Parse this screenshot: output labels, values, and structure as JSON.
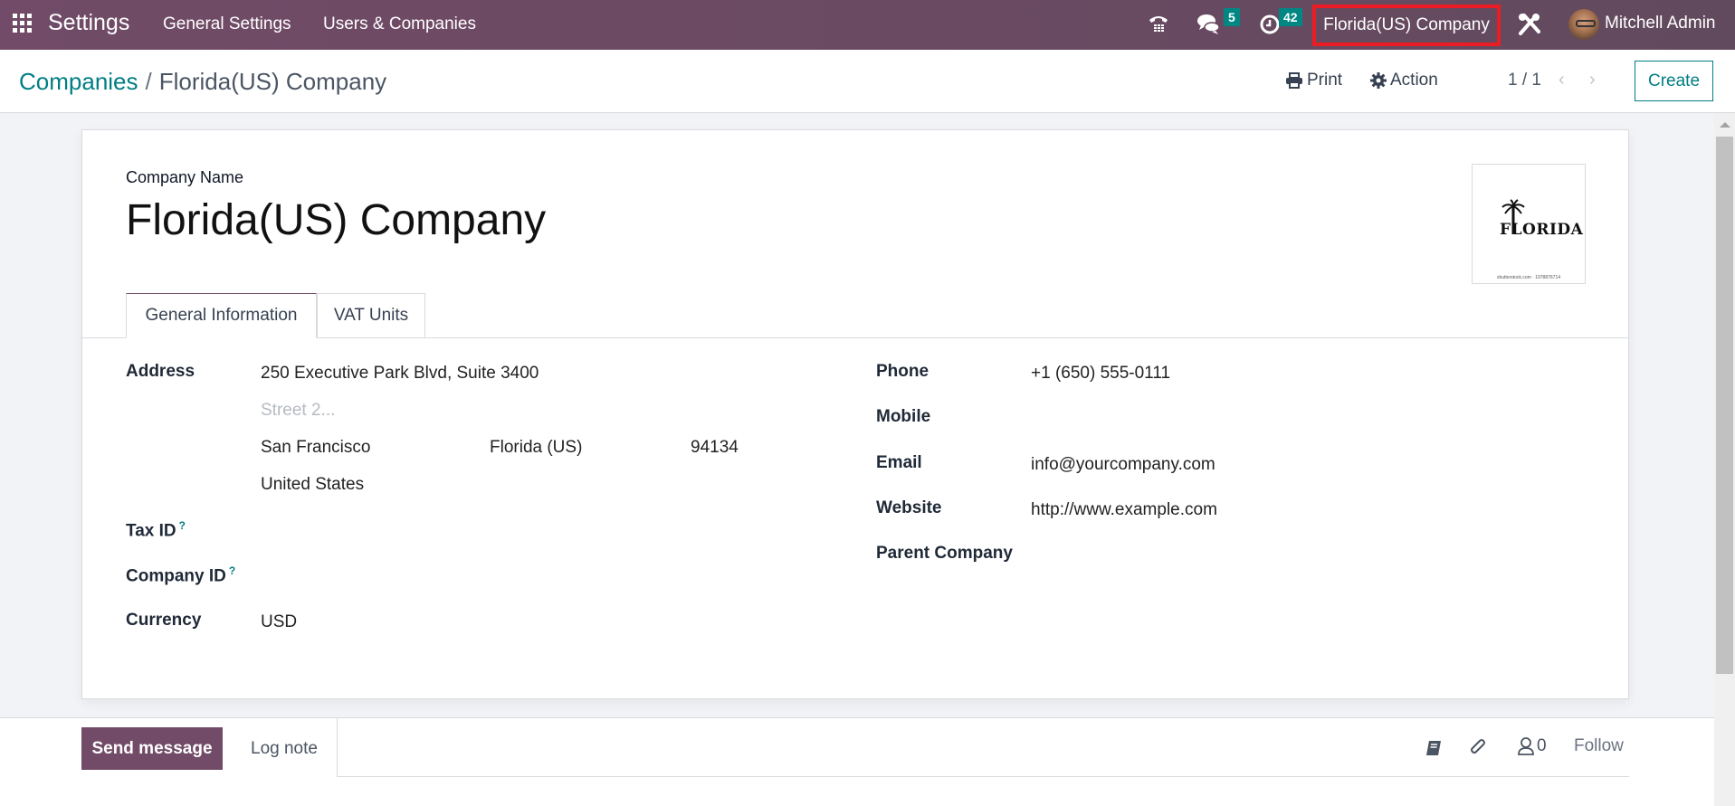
{
  "navbar": {
    "app_name": "Settings",
    "menus": [
      "General Settings",
      "Users & Companies"
    ],
    "messages_badge": "5",
    "activities_badge": "42",
    "current_company": "Florida(US) Company",
    "user_name": "Mitchell Admin",
    "colors": {
      "navbar": "#714b67",
      "badge": "#008784",
      "highlight": "#ec1c24"
    }
  },
  "control_panel": {
    "breadcrumb": {
      "parent": "Companies",
      "separator": "/",
      "current": "Florida(US) Company"
    },
    "print_label": "Print",
    "action_label": "Action",
    "pager": "1 / 1",
    "prev_glyph": "‹",
    "next_glyph": "›",
    "create_label": "Create"
  },
  "form": {
    "name_label": "Company Name",
    "name_value": "Florida(US) Company",
    "logo": {
      "text": "FLORIDA",
      "footer": "shutterstock.com · 1978876714"
    },
    "tabs": [
      {
        "label": "General Information",
        "active": true
      },
      {
        "label": "VAT Units",
        "active": false
      }
    ],
    "left_fields": {
      "address_label": "Address",
      "street": "250 Executive Park Blvd, Suite 3400",
      "street2_placeholder": "Street 2...",
      "city": "San Francisco",
      "state": "Florida (US)",
      "zip": "94134",
      "country": "United States",
      "tax_id_label": "Tax ID",
      "company_id_label": "Company ID",
      "help_mark": "?",
      "currency_label": "Currency",
      "currency_value": "USD"
    },
    "right_fields": {
      "phone_label": "Phone",
      "phone_value": "+1 (650) 555-0111",
      "mobile_label": "Mobile",
      "email_label": "Email",
      "email_value": "info@yourcompany.com",
      "website_label": "Website",
      "website_value": "http://www.example.com",
      "parent_label": "Parent Company"
    }
  },
  "chatter": {
    "send_message_label": "Send message",
    "log_note_label": "Log note",
    "followers_count": "0",
    "follow_label": "Follow"
  }
}
